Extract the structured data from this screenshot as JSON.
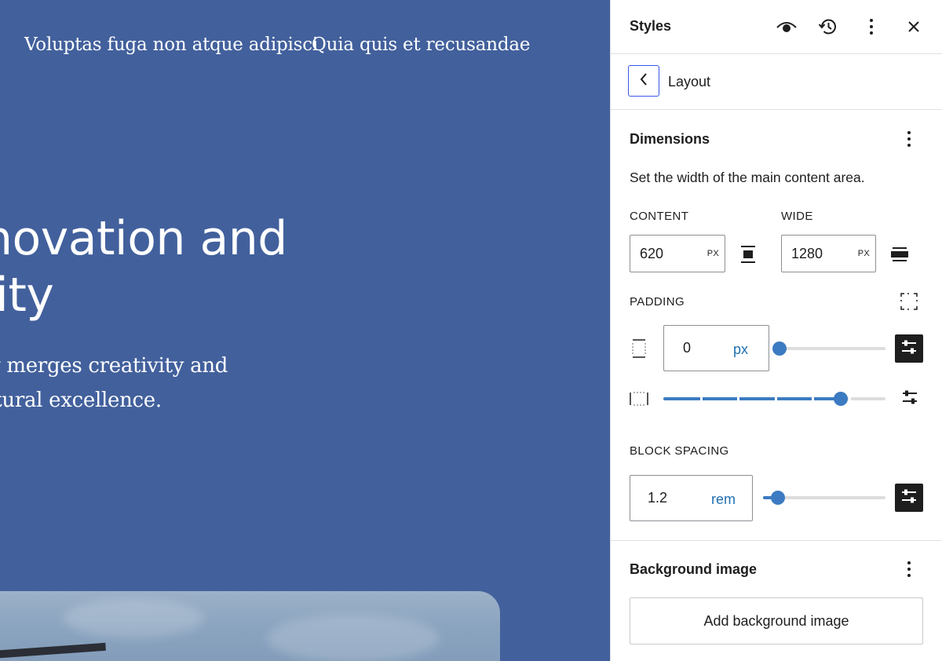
{
  "canvas": {
    "nav_links": [
      "Voluptas fuga non atque adipisci",
      "Quia quis et recusandae"
    ],
    "hero_heading_line1": "novation and",
    "hero_heading_line2": "lity",
    "hero_subtext_line1": "ly merges creativity and",
    "hero_subtext_line2": "ctural excellence.",
    "background_color": "#42609c"
  },
  "panel": {
    "title": "Styles",
    "header_icons": [
      "eye-icon",
      "history-icon",
      "more-vertical-icon",
      "close-icon"
    ],
    "breadcrumb": {
      "back_icon": "chevron-left-icon",
      "title": "Layout"
    },
    "dimensions": {
      "title": "Dimensions",
      "description": "Set the width of the main content area.",
      "content_label": "CONTENT",
      "content_value": "620",
      "content_unit": "PX",
      "wide_label": "WIDE",
      "wide_value": "1280",
      "wide_unit": "PX",
      "padding_label": "PADDING",
      "padding_value": "0",
      "padding_unit": "px",
      "padding_slider_level": 0,
      "padding_horizontal_preset_level": 0.8,
      "block_spacing_label": "BLOCK SPACING",
      "block_spacing_value": "1.2",
      "block_spacing_unit": "rem",
      "block_spacing_slider_level": 0.12
    },
    "background": {
      "title": "Background image",
      "add_button": "Add background image"
    },
    "accent_color": "#3858e9",
    "slider_color": "#3c7bc2"
  }
}
